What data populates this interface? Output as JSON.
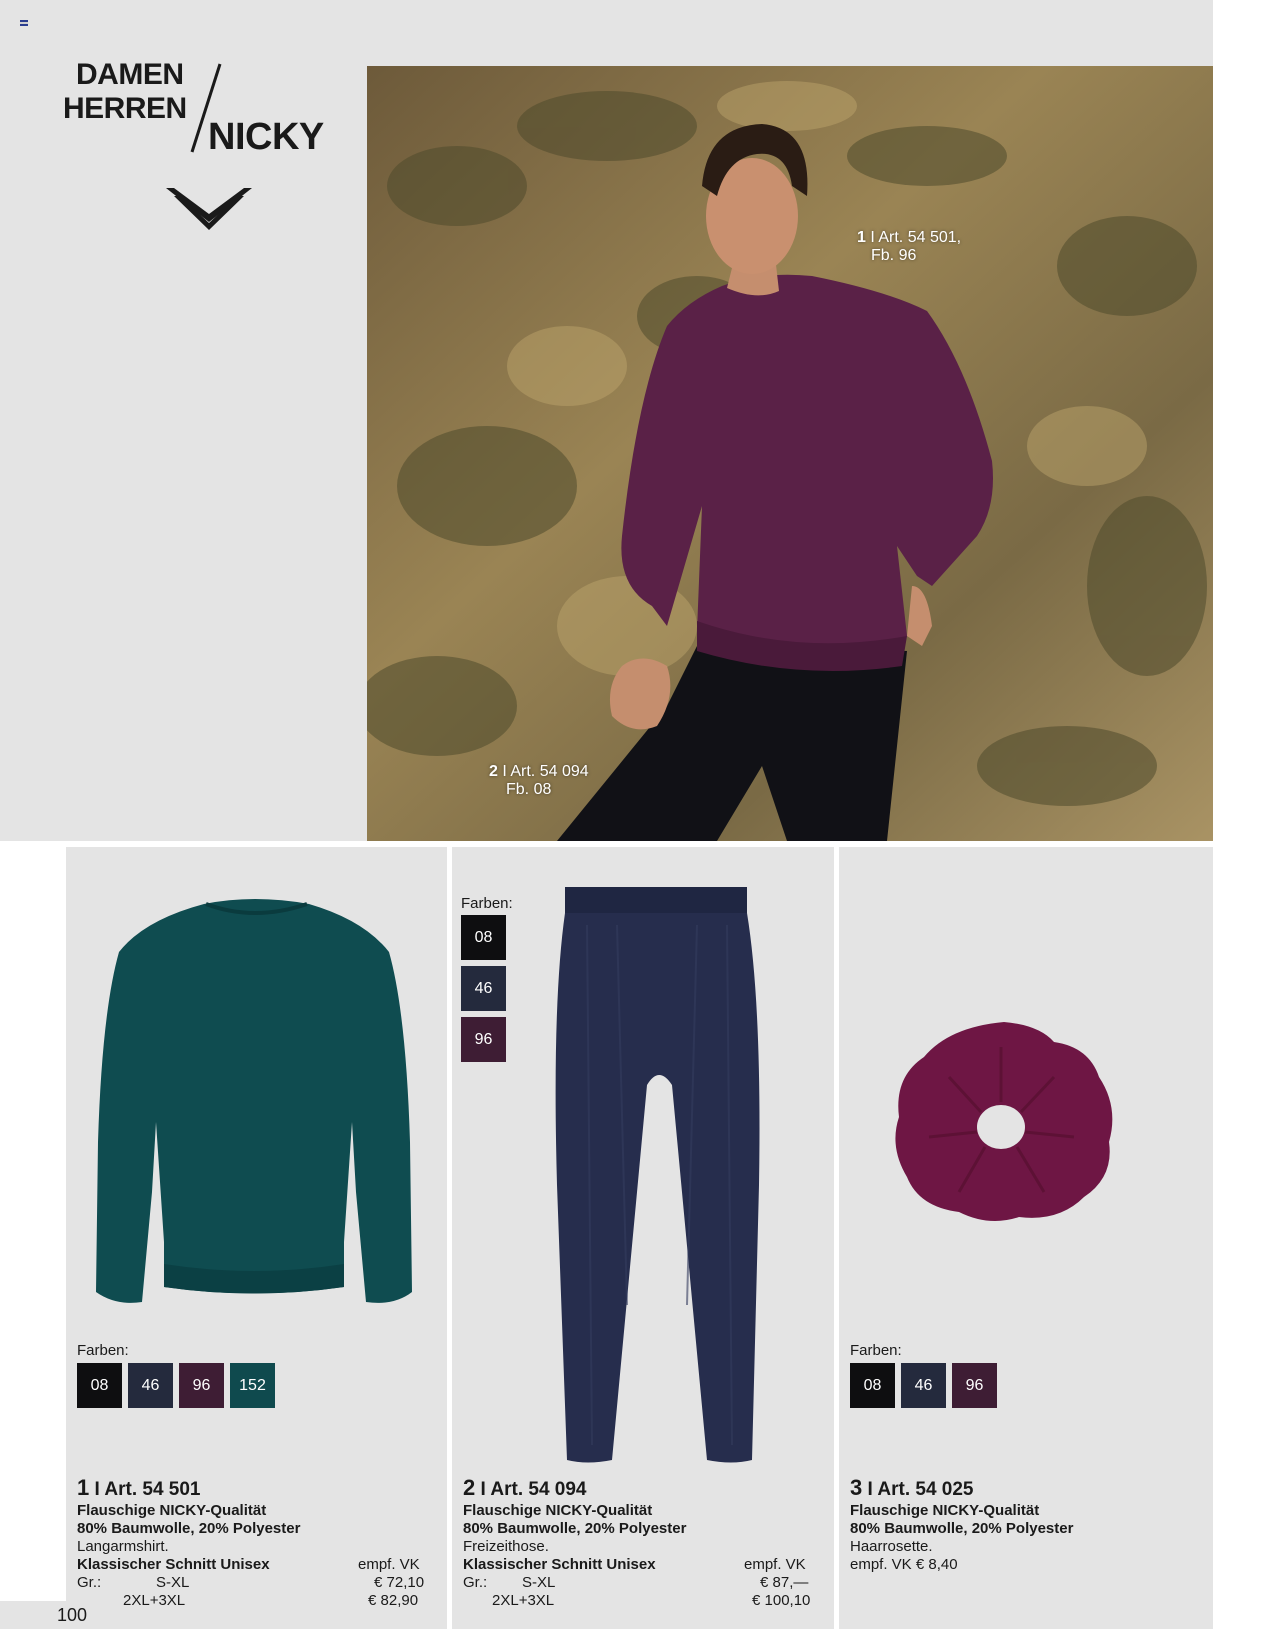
{
  "header": {
    "brand_line1": "DAMEN",
    "brand_line2": "HERREN",
    "brand_line3": "NICKY",
    "logo_icon": "chevron-wings-logo"
  },
  "photo": {
    "label1_num": "1",
    "label1_rest": " I Art. 54 501,",
    "label1_line2": "Fb. 96",
    "label2_num": "2",
    "label2_rest": " I Art. 54 094",
    "label2_line2": "Fb. 08"
  },
  "colors": {
    "c08": "#0e0e10",
    "c46": "#242a3d",
    "c96": "#3e1d34",
    "c152": "#0f4a4e",
    "sweater_purple": "#5a2147",
    "sweater_teal": "#0f4c50",
    "pants_navy": "#262d4d",
    "scrunchie": "#6e1644"
  },
  "products": [
    {
      "num": "1",
      "art": " I Art. 54 501",
      "farben_label": "Farben:",
      "swatches": [
        "08",
        "46",
        "96",
        "152"
      ],
      "line1": "Flauschige NICKY-Qualität",
      "line2": "80% Baumwolle, 20% Polyester",
      "line3": "Langarmshirt.",
      "line4": "Klassischer Schnitt Unisex",
      "vk_label": "empf. VK",
      "size_label": "Gr.:",
      "size1": "S-XL",
      "price1": "€ 72,10",
      "size2": "2XL+3XL",
      "price2": "€ 82,90"
    },
    {
      "num": "2",
      "art": " I Art. 54 094",
      "farben_label": "Farben:",
      "swatches": [
        "08",
        "46",
        "96"
      ],
      "line1": "Flauschige NICKY-Qualität",
      "line2": "80% Baumwolle, 20% Polyester",
      "line3": "Freizeithose.",
      "line4": "Klassischer Schnitt Unisex",
      "vk_label": "empf. VK",
      "size_label": "Gr.:",
      "size1": "S-XL",
      "price1": "€ 87,—",
      "size2": "2XL+3XL",
      "price2": "€ 100,10"
    },
    {
      "num": "3",
      "art": " I Art. 54 025",
      "farben_label": "Farben:",
      "swatches": [
        "08",
        "46",
        "96"
      ],
      "line1": "Flauschige NICKY-Qualität",
      "line2": "80% Baumwolle, 20% Polyester",
      "line3": "Haarrosette.",
      "line4": "empf. VK  € 8,40"
    }
  ],
  "page_number": "100"
}
